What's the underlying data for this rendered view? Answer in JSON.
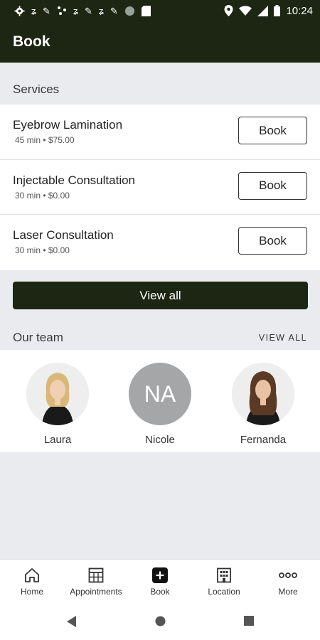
{
  "status_bar": {
    "time": "10:24",
    "left_icons": [
      "gear-icon",
      "notification-icon",
      "tool-icon",
      "share-icon",
      "notification-icon",
      "tool-icon",
      "notification-icon",
      "tool-icon",
      "circle-icon",
      "sd-card-icon"
    ],
    "right_icons": [
      "location-icon",
      "wifi-icon",
      "signal-icon",
      "battery-icon"
    ]
  },
  "app_bar": {
    "title": "Book"
  },
  "services": {
    "header": "Services",
    "items": [
      {
        "name": "Eyebrow Lamination",
        "meta": "45 min • $75.00",
        "button": "Book"
      },
      {
        "name": "Injectable Consultation",
        "meta": "30 min • $0.00",
        "button": "Book"
      },
      {
        "name": "Laser Consultation",
        "meta": "30 min • $0.00",
        "button": "Book"
      }
    ],
    "view_all": "View all"
  },
  "team": {
    "header": "Our team",
    "view_all": "VIEW ALL",
    "members": [
      {
        "name": "Laura",
        "avatar": "photo"
      },
      {
        "name": "Nicole",
        "initials": "NA"
      },
      {
        "name": "Fernanda",
        "avatar": "photo"
      }
    ]
  },
  "bottom_nav": {
    "items": [
      {
        "label": "Home",
        "icon": "home-icon"
      },
      {
        "label": "Appointments",
        "icon": "calendar-icon"
      },
      {
        "label": "Book",
        "icon": "add-icon"
      },
      {
        "label": "Location",
        "icon": "building-icon"
      },
      {
        "label": "More",
        "icon": "more-icon"
      }
    ]
  },
  "colors": {
    "brand": "#1c2612",
    "background": "#e9ebee",
    "avatar_placeholder": "#a4a6a8"
  }
}
